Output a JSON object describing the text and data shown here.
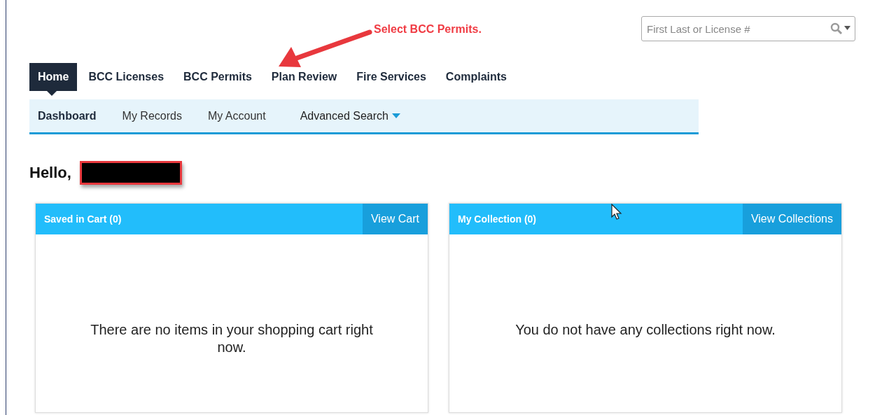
{
  "search": {
    "placeholder": "First Last or License #"
  },
  "annotation": {
    "text": "Select BCC Permits."
  },
  "tabs": [
    {
      "label": "Home",
      "selected": true
    },
    {
      "label": "BCC Licenses",
      "selected": false
    },
    {
      "label": "BCC Permits",
      "selected": false
    },
    {
      "label": "Plan Review",
      "selected": false
    },
    {
      "label": "Fire Services",
      "selected": false
    },
    {
      "label": "Complaints",
      "selected": false
    }
  ],
  "subnav": [
    {
      "label": "Dashboard",
      "selected": true,
      "kind": "link"
    },
    {
      "label": "My Records",
      "selected": false,
      "kind": "link"
    },
    {
      "label": "My Account",
      "selected": false,
      "kind": "link"
    },
    {
      "label": "Advanced Search",
      "selected": false,
      "kind": "dropdown"
    }
  ],
  "greeting": "Hello,",
  "cards": [
    {
      "title": "Saved in Cart (0)",
      "action": "View Cart",
      "message": "There are no items in your shopping cart right now."
    },
    {
      "title": "My Collection (0)",
      "action": "View Collections",
      "message": "You do not have any collections right now."
    }
  ]
}
